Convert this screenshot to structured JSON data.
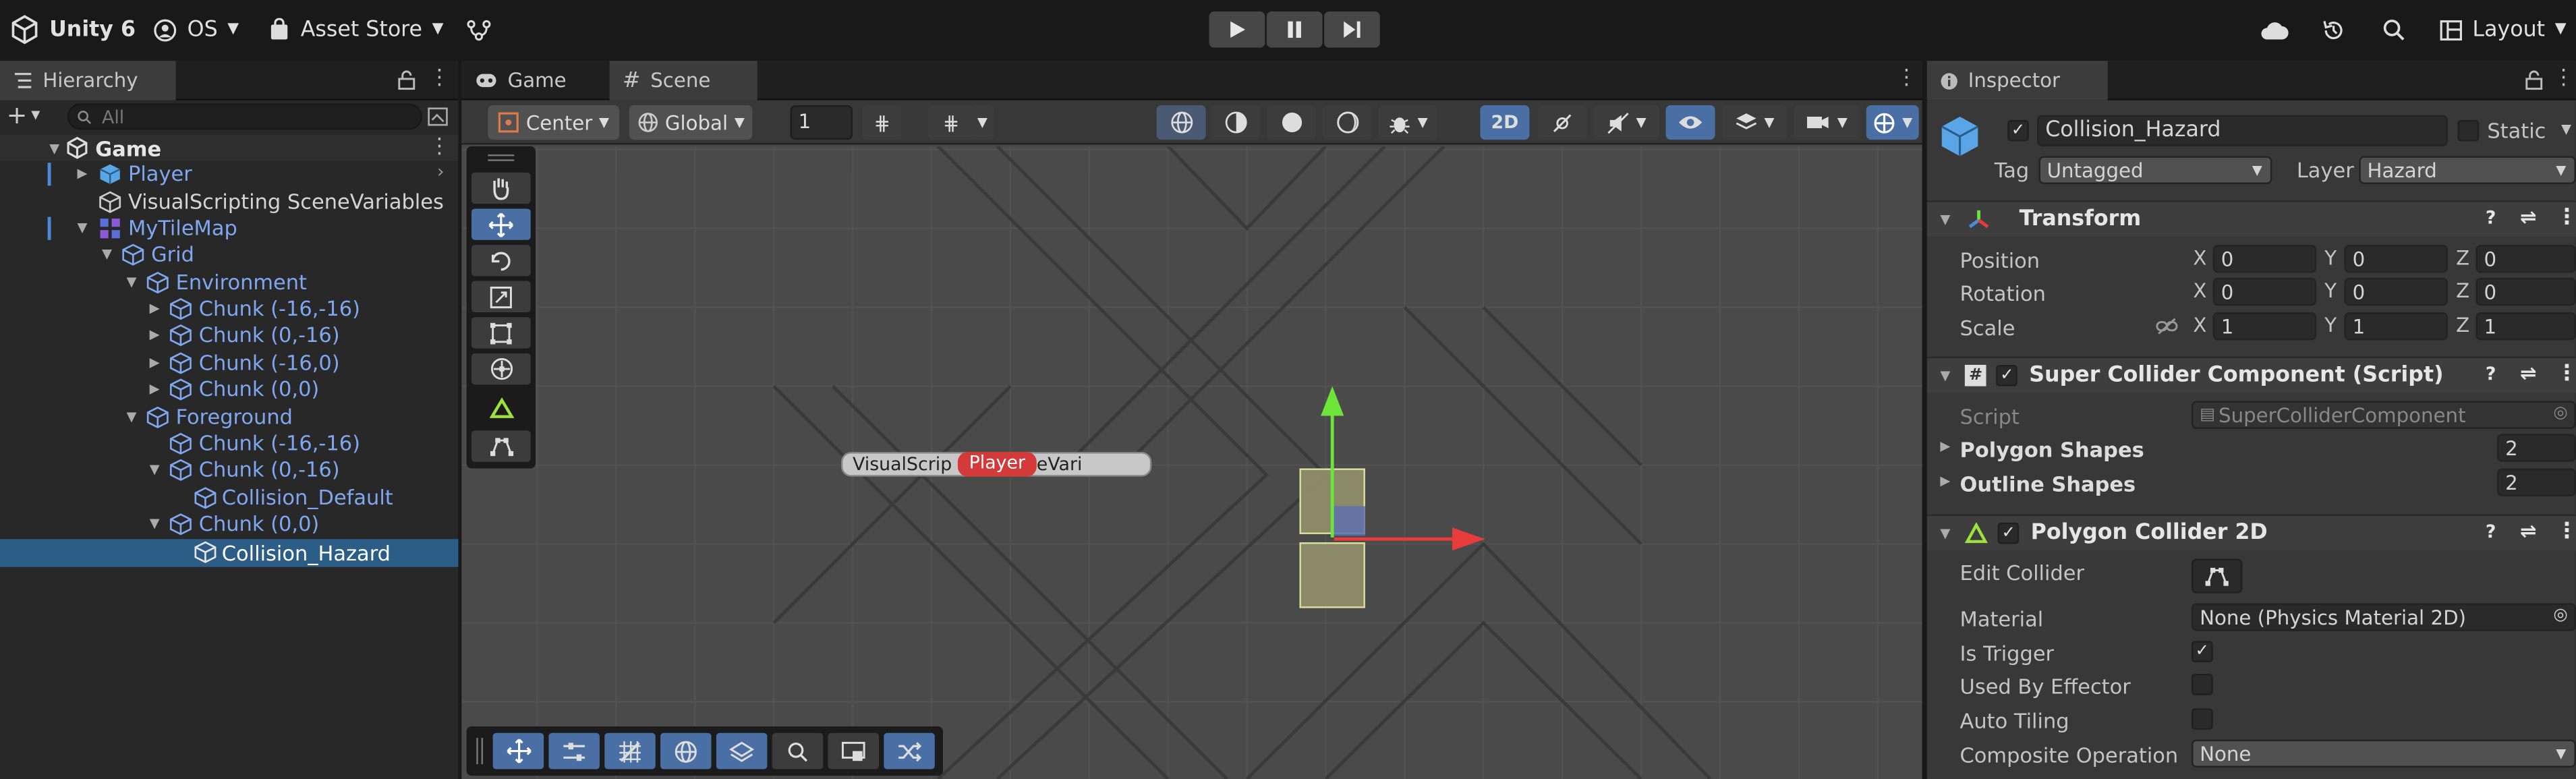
{
  "topbar": {
    "app_label": "Unity 6",
    "account_label": "OS",
    "asset_store_label": "Asset Store",
    "layout_label": "Layout"
  },
  "hierarchy": {
    "tab_label": "Hierarchy",
    "search_placeholder": "All",
    "scene_name": "Game",
    "rows": [
      {
        "label": "Player"
      },
      {
        "label": "VisualScripting SceneVariables"
      },
      {
        "label": "MyTileMap"
      },
      {
        "label": "Grid"
      },
      {
        "label": "Environment"
      },
      {
        "label": "Chunk (-16,-16)"
      },
      {
        "label": "Chunk (0,-16)"
      },
      {
        "label": "Chunk (-16,0)"
      },
      {
        "label": "Chunk (0,0)"
      },
      {
        "label": "Foreground"
      },
      {
        "label": "Chunk (-16,-16)"
      },
      {
        "label": "Chunk (0,-16)"
      },
      {
        "label": "Collision_Default"
      },
      {
        "label": "Chunk (0,0)"
      },
      {
        "label": "Collision_Hazard"
      }
    ]
  },
  "scene": {
    "tabs": [
      {
        "label": "Game"
      },
      {
        "label": "Scene"
      }
    ],
    "pivot_label": "Center",
    "space_label": "Global",
    "grid_snap_value": "1",
    "mode_2d_label": "2D",
    "overlay_label_text": "VisualScrip",
    "overlay_badge": "Player",
    "overlay_label_tail": "eVari"
  },
  "inspector": {
    "tab_label": "Inspector",
    "object_name": "Collision_Hazard",
    "static_label": "Static",
    "tag_label": "Tag",
    "tag_value": "Untagged",
    "layer_label": "Layer",
    "layer_value": "Hazard",
    "transform": {
      "title": "Transform",
      "position_label": "Position",
      "rotation_label": "Rotation",
      "scale_label": "Scale",
      "axis_x": "X",
      "axis_y": "Y",
      "axis_z": "Z",
      "position": [
        "0",
        "0",
        "0"
      ],
      "rotation": [
        "0",
        "0",
        "0"
      ],
      "scale": [
        "1",
        "1",
        "1"
      ]
    },
    "super_collider": {
      "title": "Super Collider Component (Script)",
      "script_label": "Script",
      "script_value": "SuperColliderComponent",
      "polygon_shapes_label": "Polygon Shapes",
      "polygon_shapes_value": "2",
      "outline_shapes_label": "Outline Shapes",
      "outline_shapes_value": "2"
    },
    "polygon_collider": {
      "title": "Polygon Collider 2D",
      "edit_collider_label": "Edit Collider",
      "material_label": "Material",
      "material_value": "None (Physics Material 2D)",
      "is_trigger_label": "Is Trigger",
      "used_by_effector_label": "Used By Effector",
      "auto_tiling_label": "Auto Tiling",
      "composite_operation_label": "Composite Operation",
      "composite_operation_value": "None"
    }
  },
  "colors": {
    "selection": "#2c5d87",
    "accent_blue": "#4a6fa5",
    "gizmo_y": "#6ce43a",
    "gizmo_x": "#e83b3b"
  }
}
